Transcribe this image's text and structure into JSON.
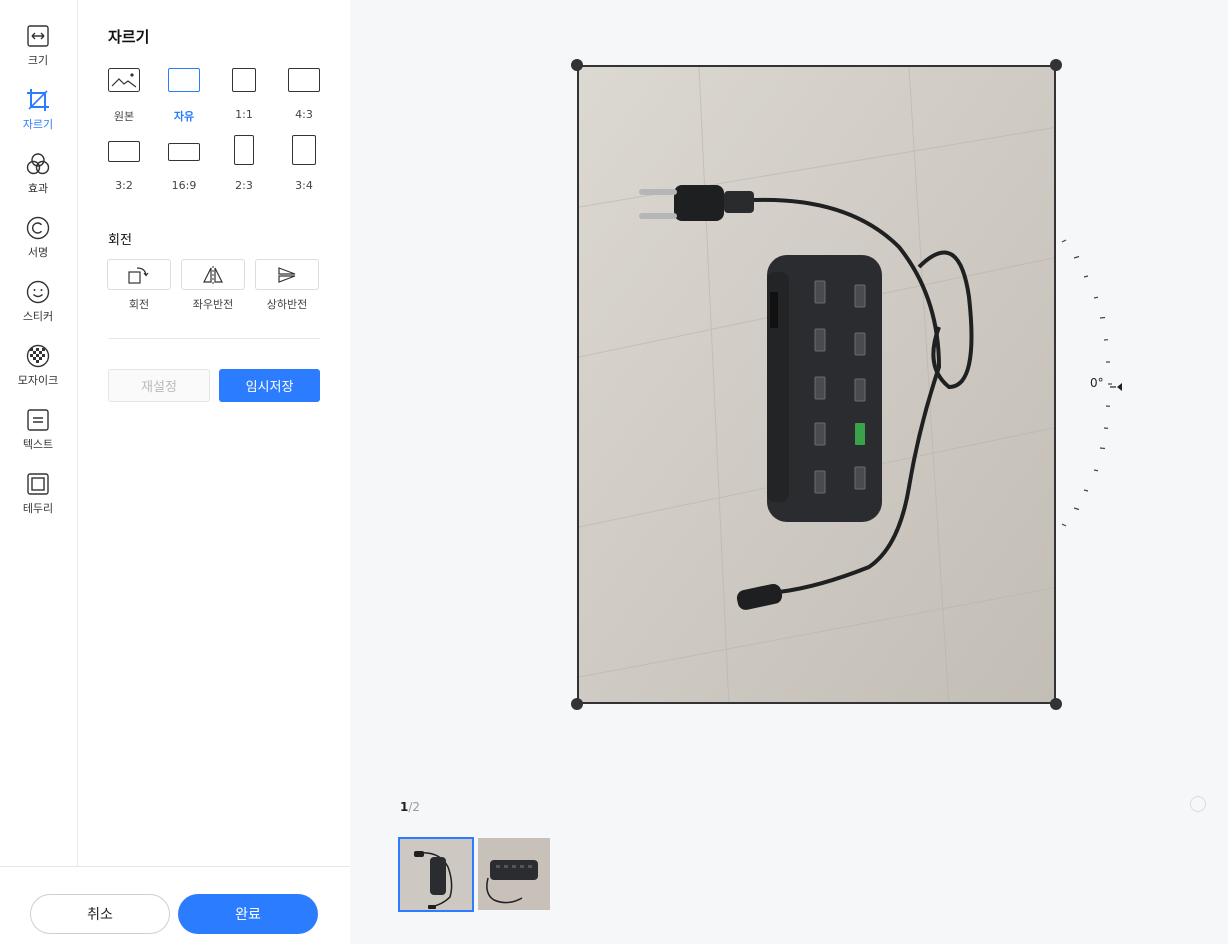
{
  "rail": {
    "items": [
      {
        "label": "크기",
        "icon": "resize-icon"
      },
      {
        "label": "자르기",
        "icon": "crop-icon",
        "active": true
      },
      {
        "label": "효과",
        "icon": "effects-icon"
      },
      {
        "label": "서명",
        "icon": "copyright-icon"
      },
      {
        "label": "스티커",
        "icon": "smiley-icon"
      },
      {
        "label": "모자이크",
        "icon": "mosaic-icon"
      },
      {
        "label": "텍스트",
        "icon": "text-icon"
      },
      {
        "label": "테두리",
        "icon": "border-icon"
      }
    ]
  },
  "panel": {
    "title": "자르기",
    "ratios": [
      {
        "label": "원본",
        "icon": "original-image-icon"
      },
      {
        "label": "자유",
        "active": true
      },
      {
        "label": "1:1"
      },
      {
        "label": "4:3"
      },
      {
        "label": "3:2"
      },
      {
        "label": "16:9"
      },
      {
        "label": "2:3"
      },
      {
        "label": "3:4"
      }
    ],
    "rotate_title": "회전",
    "rotate_buttons": [
      {
        "label": "회전",
        "icon": "rotate-icon"
      },
      {
        "label": "좌우반전",
        "icon": "flip-horizontal-icon"
      },
      {
        "label": "상하반전",
        "icon": "flip-vertical-icon"
      }
    ],
    "reset_label": "재설정",
    "save_label": "임시저장"
  },
  "footer": {
    "cancel_label": "취소",
    "done_label": "완료"
  },
  "canvas": {
    "angle": "0°",
    "pager": {
      "current": "1",
      "total": "/2"
    }
  },
  "colors": {
    "accent": "#2b7cff",
    "background": "#f6f7f9"
  }
}
